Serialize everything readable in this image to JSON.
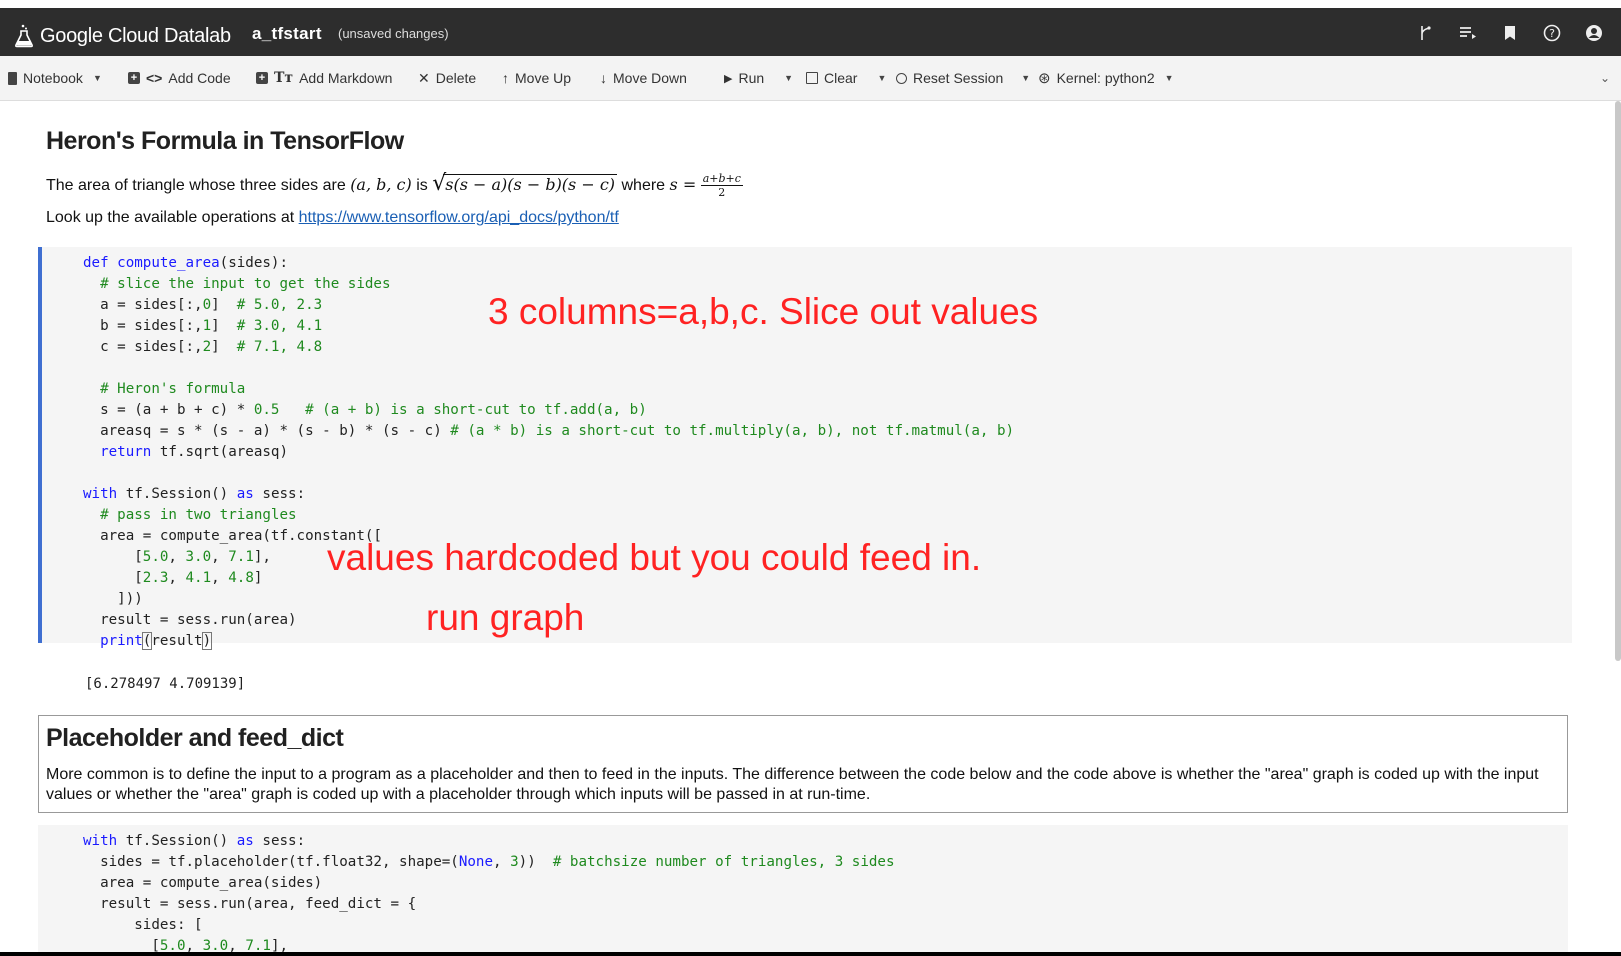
{
  "app": {
    "brand": "Google Cloud Datalab",
    "notebook_name": "a_tfstart",
    "status": "(unsaved changes)",
    "top_icons": [
      "branch-icon",
      "playlist-icon",
      "bookmark-icon",
      "help-icon",
      "account-icon"
    ]
  },
  "toolbar": {
    "notebook": "Notebook",
    "add_code": "Add Code",
    "add_markdown": "Add Markdown",
    "delete": "Delete",
    "move_up": "Move Up",
    "move_down": "Move Down",
    "run": "Run",
    "clear": "Clear",
    "reset_session": "Reset Session",
    "kernel": "Kernel: python2"
  },
  "heron": {
    "title": "Heron's Formula in TensorFlow",
    "text_prefix": "The area of triangle whose three sides are",
    "sides": "(a, b, c)",
    "is": "is",
    "sqrt_expr": "s(s − a)(s − b)(s − c)",
    "where": "where",
    "s_eq": "s =",
    "frac_num": "a+b+c",
    "frac_den": "2",
    "lookup_text": "Look up the available operations at",
    "link": "https://www.tensorflow.org/api_docs/python/tf"
  },
  "code1": {
    "l1a": "def",
    "l1b": " compute_area",
    "l1c": "(sides):",
    "l2": "  # slice the input to get the sides",
    "l3a": "  a = sides[:,",
    "l3n": "0",
    "l3b": "]  ",
    "l3c": "# 5.0, 2.3",
    "l4a": "  b = sides[:,",
    "l4n": "1",
    "l4b": "]  ",
    "l4c": "# 3.0, 4.1",
    "l5a": "  c = sides[:,",
    "l5n": "2",
    "l5b": "]  ",
    "l5c": "# 7.1, 4.8",
    "l7": "  # Heron's formula",
    "l8a": "  s = (a + b + c) * ",
    "l8n": "0.5",
    "l8b": "   ",
    "l8c": "# (a + b) is a short-cut to tf.add(a, b)",
    "l9a": "  areasq = s * (s - a) * (s - b) * (s - c) ",
    "l9c": "# (a * b) is a short-cut to tf.multiply(a, b), not tf.matmul(a, b)",
    "l10a": "  return",
    "l10b": " tf.sqrt(areasq)",
    "l12a": "with",
    "l12b": " tf.Session() ",
    "l12c": "as",
    "l12d": " sess:",
    "l13": "  # pass in two triangles",
    "l14": "  area = compute_area(tf.constant([",
    "l15a": "      [",
    "l15n1": "5.0",
    "l15s1": ", ",
    "l15n2": "3.0",
    "l15s2": ", ",
    "l15n3": "7.1",
    "l15b": "],",
    "l16a": "      [",
    "l16n1": "2.3",
    "l16s1": ", ",
    "l16n2": "4.1",
    "l16s2": ", ",
    "l16n3": "4.8",
    "l16b": "]",
    "l17": "    ]))",
    "l18": "  result = sess.run(area)",
    "l19a": "  print",
    "l19b": "(",
    "l19c": "result",
    "l19d": ")"
  },
  "annotations": {
    "a1": "3 columns=a,b,c.  Slice out values",
    "a2": "values hardcoded but you could feed in.",
    "a3": "run graph"
  },
  "output1": "[6.278497 4.709139]",
  "placeholder": {
    "title": "Placeholder and feed_dict",
    "text": "More common is to define the input to a program as a placeholder and then to feed in the inputs. The difference between the code below and the code above is whether the \"area\" graph is coded up with the input values or whether the \"area\" graph is coded up with a placeholder through which inputs will be passed in at run-time."
  },
  "code2": {
    "l1a": "with",
    "l1b": " tf.Session() ",
    "l1c": "as",
    "l1d": " sess:",
    "l2a": "  sides = tf.placeholder(tf.float32, shape=(",
    "l2k": "None",
    "l2s": ", ",
    "l2n": "3",
    "l2b": "))  ",
    "l2c": "# batchsize number of triangles, 3 sides",
    "l3": "  area = compute_area(sides)",
    "l4": "  result = sess.run(area, feed_dict = {",
    "l5": "      sides: [",
    "l6a": "        [",
    "l6n1": "5.0",
    "l6s1": ", ",
    "l6n2": "3.0",
    "l6s2": ", ",
    "l6n3": "7.1",
    "l6b": "],"
  }
}
